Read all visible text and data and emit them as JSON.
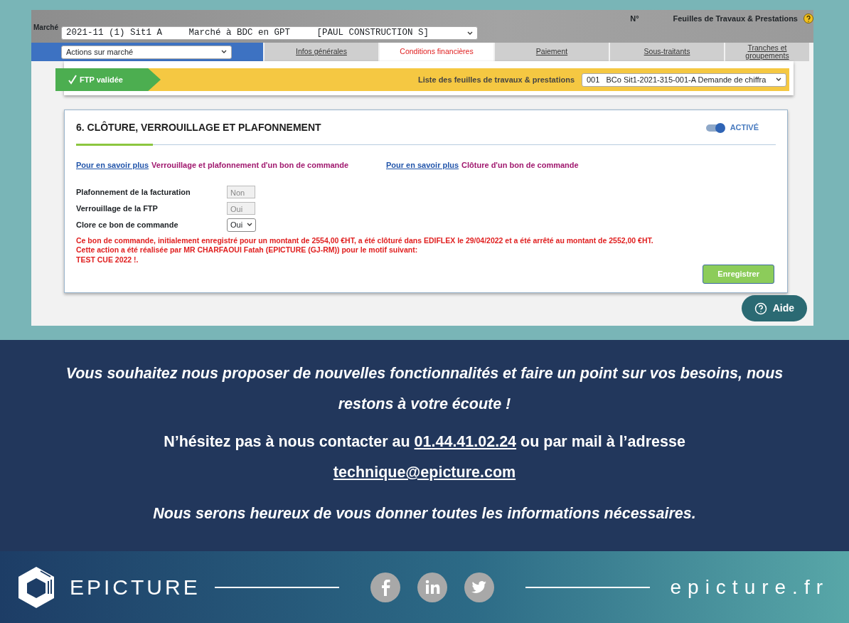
{
  "header": {
    "market_label": "Marché",
    "market_select": "2021-11 (1) Sit1 A     Marché à BDC en GPT     [PAUL CONSTRUCTION S]",
    "number_label": "N°",
    "sheets_label": "Feuilles de Travaux & Prestations"
  },
  "actions_select": "Actions sur marché",
  "tabs": [
    {
      "label": "Infos générales",
      "selected": false
    },
    {
      "label": "Conditions financières",
      "selected": true
    },
    {
      "label": "Paiement",
      "selected": false
    },
    {
      "label": "Sous-traitants",
      "selected": false
    },
    {
      "label": "Tranches et groupements",
      "selected": false
    }
  ],
  "status_banner": {
    "badge": "FTP validée",
    "list_label": "Liste des feuilles de travaux & prestations",
    "list_select": "001   BCo Sit1-2021-315-001-A Demande de chiffra"
  },
  "section": {
    "title": "6. CLÔTURE, VERROUILLAGE ET PLAFONNEMENT",
    "toggle": {
      "label": "ACTIVÉ",
      "on": true
    },
    "links": [
      {
        "link": "Pour en savoir plus",
        "text": "Verrouillage et plafonnement d'un bon de commande"
      },
      {
        "link": "Pour en savoir plus",
        "text": "Clôture d'un bon de commande"
      }
    ],
    "fields": [
      {
        "label": "Plafonnement de la facturation",
        "value": "Non",
        "kind": "readonly"
      },
      {
        "label": "Verrouillage de la FTP",
        "value": "Oui",
        "kind": "readonly"
      },
      {
        "label": "Clore ce bon de commande",
        "value": "Oui",
        "kind": "select"
      }
    ],
    "message": [
      "Ce bon de commande, initialement enregistré pour un montant de 2554,00 €HT, a été clôturé dans EDIFLEX le 29/04/2022 et a été arrêté au montant de 2552,00 €HT.",
      "Cette action a été réalisée par MR CHARFAOUI Fatah (EPICTURE (GJ-RM)) pour le motif suivant:",
      "TEST CUE 2022 !."
    ],
    "save_button": "Enregistrer"
  },
  "help_button": "Aide",
  "contact": {
    "invite": "Vous souhaitez nous proposer de nouvelles fonctionnalités et faire un point sur vos besoins, nous restons à votre écoute !",
    "prefix": "N’hésitez pas à nous contacter au",
    "phone": "01.44.41.02.24",
    "middle": "ou par mail à l’adresse",
    "email": "technique@epicture.com",
    "closing": "Nous serons heureux de vous donner toutes les informations nécessaires."
  },
  "footer": {
    "brand": "EPICTURE",
    "website": "epicture.fr"
  }
}
